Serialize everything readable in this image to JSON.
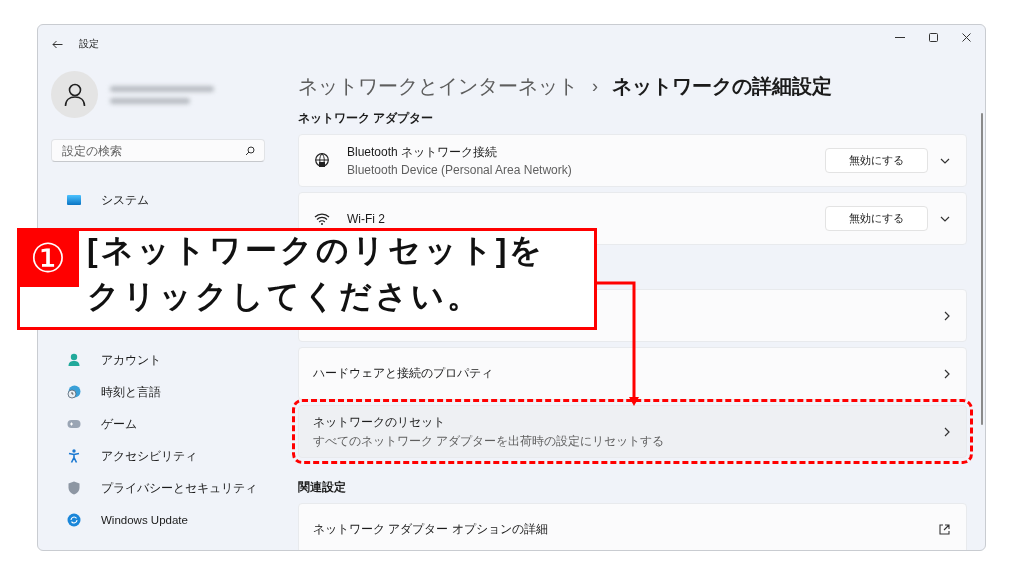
{
  "window": {
    "title": "設定"
  },
  "sidebar": {
    "search": {
      "placeholder": "設定の検索"
    },
    "items": [
      {
        "label": "システム"
      },
      {
        "label": "アカウント"
      },
      {
        "label": "時刻と言語"
      },
      {
        "label": "ゲーム"
      },
      {
        "label": "アクセシビリティ"
      },
      {
        "label": "プライバシーとセキュリティ"
      },
      {
        "label": "Windows Update"
      }
    ]
  },
  "breadcrumb": {
    "parent": "ネットワークとインターネット",
    "separator": "›",
    "current": "ネットワークの詳細設定"
  },
  "sections": [
    {
      "heading": "ネットワーク アダプター",
      "items": [
        {
          "kind": "adapter",
          "title": "Bluetooth ネットワーク接続",
          "subtitle": "Bluetooth Device (Personal Area Network)",
          "button": "無効にする",
          "highlighted": false
        },
        {
          "kind": "adapter",
          "title": "Wi-Fi 2",
          "button": "無効にする",
          "highlighted": false
        }
      ]
    },
    {
      "items": [
        {
          "kind": "link",
          "highlighted": false
        },
        {
          "kind": "link",
          "title": "ハードウェアと接続のプロパティ",
          "highlighted": false
        },
        {
          "kind": "link",
          "title": "ネットワークのリセット",
          "subtitle": "すべてのネットワーク アダプターを出荷時の設定にリセットする",
          "highlighted": true
        }
      ]
    },
    {
      "heading": "関連設定",
      "items": [
        {
          "kind": "external",
          "title": "ネットワーク アダプター オプションの詳細",
          "highlighted": false
        }
      ]
    }
  ],
  "callout": {
    "number": "①",
    "lines": [
      "[ネットワークのリセット]を",
      "クリックしてください。"
    ]
  }
}
